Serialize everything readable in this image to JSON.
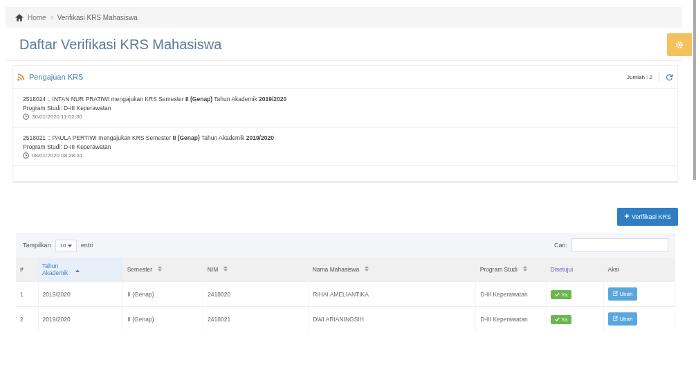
{
  "breadcrumb": [
    "Home",
    "Verifikasi KRS Mahasiswa"
  ],
  "page_title": "Daftar Verifikasi KRS Mahasiswa",
  "panel": {
    "title": "Pengajuan KRS",
    "count": "Jumlah : 2",
    "items": [
      {
        "text": "2518024 :: INTAN NUR PRATIWI mengajukan KRS Semester **II (Genap)** Tahun Akademik **2019/2020**",
        "program": "Program Studi: D-III Keperawatan",
        "time": "30/01/2020 11:02:30"
      },
      {
        "text": "2518021 :: PAULA PERTIWI mengajukan KRS Semester **II (Genap)** Tahun Akademik **2019/2020**",
        "program": "Program Studi: D-III Keperawatan",
        "time": "08/01/2020 08:28:31"
      }
    ]
  },
  "add_button": "Verifikasi KRS",
  "table": {
    "show_label": "Tampilkan",
    "page_size": "10",
    "entries_label": "entri",
    "search_label": "Cari:",
    "columns": [
      {
        "label": "#",
        "sortable": false,
        "sorted": false
      },
      {
        "label": "Tahun Akademik",
        "sortable": true,
        "sorted": true
      },
      {
        "label": "Semester",
        "sortable": true,
        "sorted": false
      },
      {
        "label": "NIM",
        "sortable": true,
        "sorted": false
      },
      {
        "label": "Nama Mahasiswa",
        "sortable": true,
        "sorted": false
      },
      {
        "label": "Program Studi",
        "sortable": true,
        "sorted": false
      },
      {
        "label": "Disetujui",
        "sortable": false,
        "sorted": false
      },
      {
        "label": "Aksi",
        "sortable": false,
        "sorted": false
      }
    ],
    "rows": [
      {
        "cells": [
          "1",
          "2019/2020",
          "II (Genap)",
          "2418020",
          "RIHAI AMELIANTIKA",
          "D-III Keperawatan"
        ],
        "approved": true,
        "status": "Ya",
        "action": "Ubah"
      },
      {
        "cells": [
          "2",
          "2019/2020",
          "II (Genap)",
          "2418021",
          "DWI ARIANINGSIH",
          "D-III Keperawatan"
        ],
        "approved": true,
        "status": "Ya",
        "action": "Ubah"
      }
    ]
  }
}
